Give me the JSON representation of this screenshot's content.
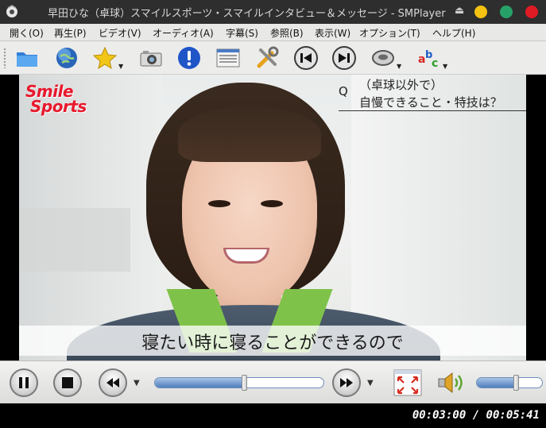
{
  "window": {
    "title": "早田ひな（卓球）スマイルスポーツ・スマイルインタビュー＆メッセージ - SMPlayer",
    "controls": {
      "minimize_color": "#f5c211",
      "maximize_color": "#26a269",
      "close_color": "#e01b24"
    }
  },
  "menubar": {
    "items": [
      {
        "label": "開く(O)"
      },
      {
        "label": "再生(P)"
      },
      {
        "label": "ビデオ(V)"
      },
      {
        "label": "オーディオ(A)"
      },
      {
        "label": "字幕(S)"
      },
      {
        "label": "参照(B)"
      },
      {
        "label": "表示(W)"
      },
      {
        "label": "オプション(T)"
      },
      {
        "label": "ヘルプ(H)"
      }
    ]
  },
  "toolbar": {
    "buttons": [
      {
        "icon": "folder-icon"
      },
      {
        "icon": "globe-icon"
      },
      {
        "icon": "star-icon",
        "has_menu": true
      },
      {
        "icon": "camera-icon"
      },
      {
        "icon": "info-icon"
      },
      {
        "icon": "playlist-icon"
      },
      {
        "icon": "tools-icon"
      },
      {
        "icon": "previous-icon"
      },
      {
        "icon": "next-icon"
      },
      {
        "icon": "audio-track-icon",
        "has_menu": true
      },
      {
        "icon": "subtitle-icon",
        "has_menu": true
      }
    ]
  },
  "video": {
    "logo_line1": "Smile",
    "logo_line2": "Sports",
    "question_mark": "Q",
    "question_line1": "（卓球以外で）",
    "question_line2": "自慢できること・特技は？",
    "subtitle": "寝たい時に寝ることができるので"
  },
  "controlbar": {
    "progress_fraction": 0.526,
    "volume_fraction": 0.6
  },
  "status": {
    "time": "00:03:00 / 00:05:41",
    "current": "00:03:00",
    "total": "00:05:41"
  },
  "colors": {
    "brand_red": "#e8182c",
    "slider_blue": "#4f7ebd"
  }
}
